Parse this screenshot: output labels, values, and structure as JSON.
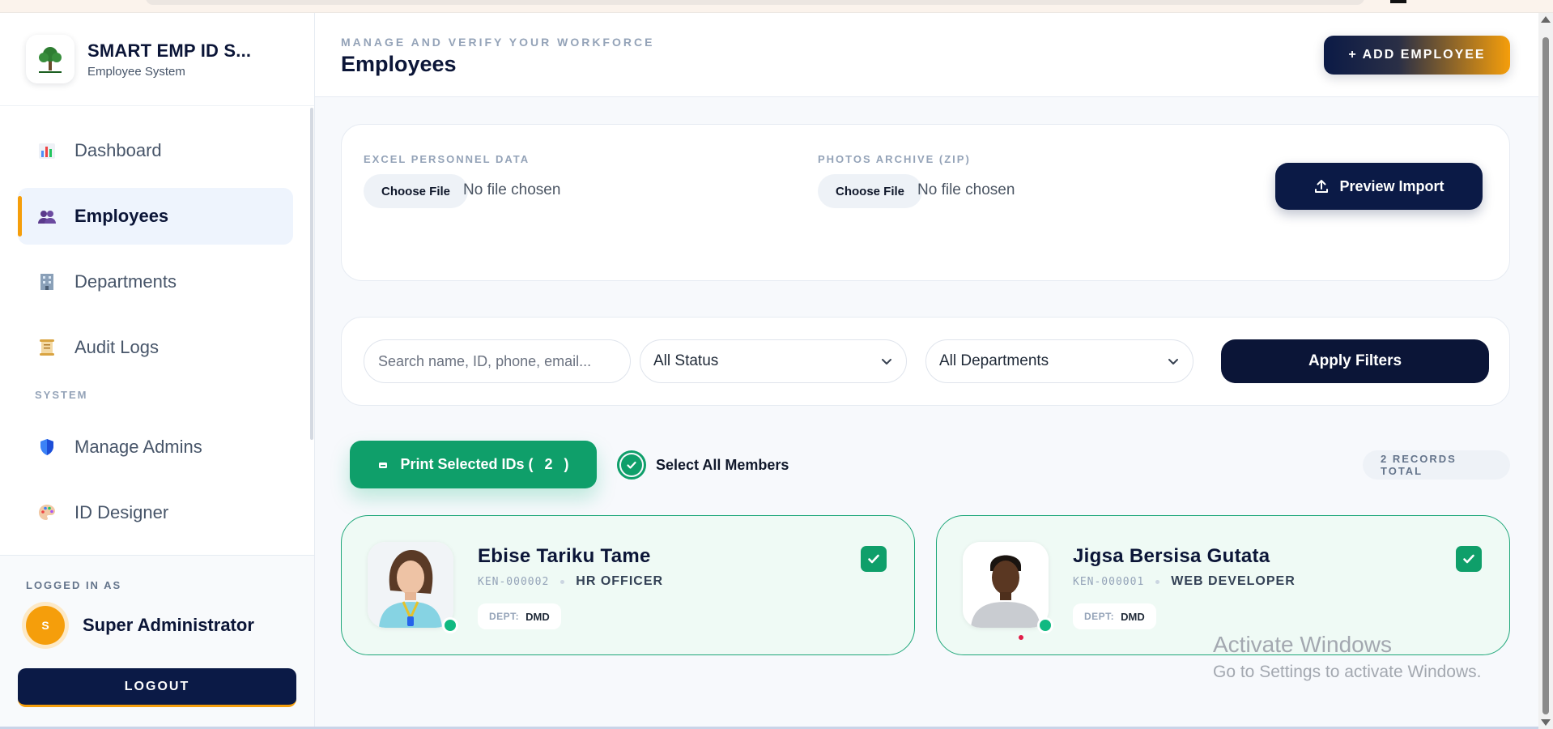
{
  "brand": {
    "title": "SMART EMP ID S...",
    "subtitle": "Employee System"
  },
  "sidebar": {
    "items": [
      {
        "label": "Dashboard",
        "icon": "bar-chart-icon",
        "active": false
      },
      {
        "label": "Employees",
        "icon": "users-icon",
        "active": true
      },
      {
        "label": "Departments",
        "icon": "building-icon",
        "active": false
      },
      {
        "label": "Audit Logs",
        "icon": "scroll-icon",
        "active": false
      }
    ],
    "section_label": "SYSTEM",
    "system_items": [
      {
        "label": "Manage Admins",
        "icon": "shield-icon"
      },
      {
        "label": "ID Designer",
        "icon": "palette-icon"
      }
    ],
    "logged_in_label": "LOGGED IN AS",
    "user": {
      "initial": "S",
      "name": "Super Administrator"
    },
    "logout_label": "LOGOUT"
  },
  "header": {
    "eyebrow": "MANAGE AND VERIFY YOUR WORKFORCE",
    "title": "Employees",
    "add_button": "+ ADD EMPLOYEE"
  },
  "import": {
    "excel_label": "EXCEL PERSONNEL DATA",
    "photos_label": "PHOTOS ARCHIVE (ZIP)",
    "choose_file": "Choose File",
    "no_file": "No file chosen",
    "preview_button": "Preview Import"
  },
  "filters": {
    "search_placeholder": "Search name, ID, phone, email...",
    "status": "All Status",
    "department": "All Departments",
    "apply_button": "Apply Filters"
  },
  "actions": {
    "print_label": "Print Selected IDs (",
    "print_count": "2",
    "print_close": ")",
    "select_all": "Select All Members",
    "records_total": "2 RECORDS TOTAL"
  },
  "employees": [
    {
      "name": "Ebise Tariku Tame",
      "id": "KEN-000002",
      "role": "HR OFFICER",
      "dept_label": "DEPT:",
      "dept": "DMD",
      "selected": true
    },
    {
      "name": "Jigsa Bersisa Gutata",
      "id": "KEN-000001",
      "role": "WEB DEVELOPER",
      "dept_label": "DEPT:",
      "dept": "DMD",
      "selected": true
    }
  ],
  "watermark": {
    "line1": "Activate Windows",
    "line2": "Go to Settings to activate Windows."
  },
  "colors": {
    "navy": "#0b1a46",
    "accent": "#f59e0b",
    "green": "#0f9f6a"
  }
}
